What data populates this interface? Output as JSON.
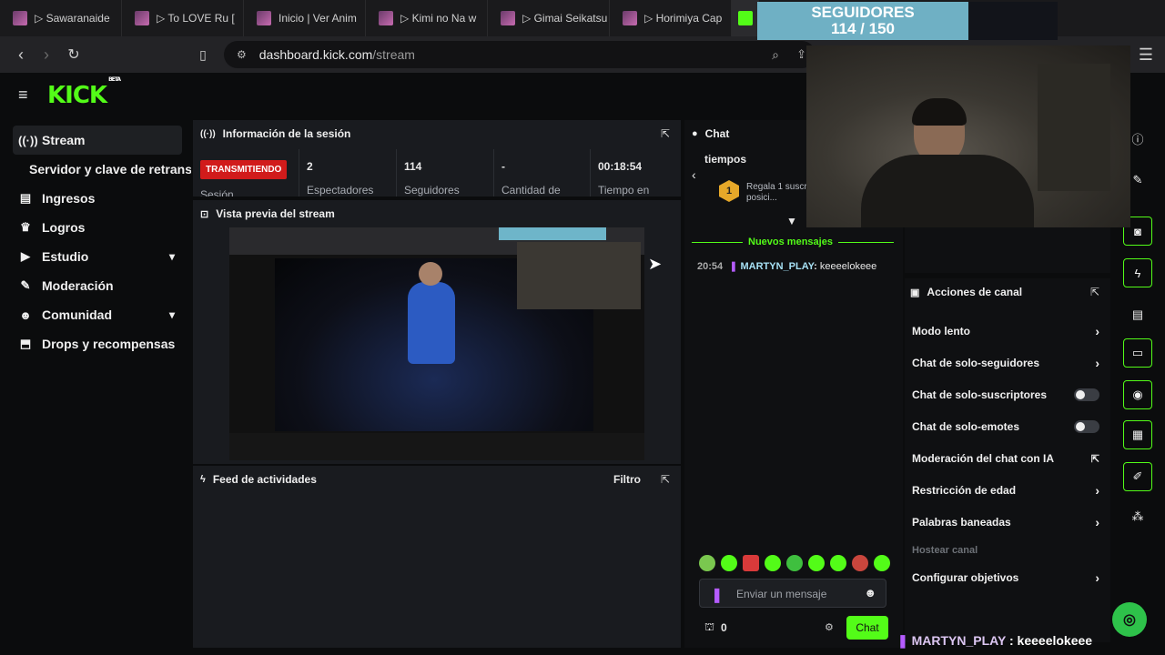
{
  "browser": {
    "tabs": [
      {
        "label": "▷ Sawaranaide"
      },
      {
        "label": "▷ To LOVE Ru ["
      },
      {
        "label": "Inicio | Ver Anim"
      },
      {
        "label": "▷ Kimi no Na w"
      },
      {
        "label": "▷ Gimai Seikatsu"
      },
      {
        "label": "▷ Horimiya Cap"
      }
    ],
    "url_host": "dashboard.kick.com",
    "url_path": "/stream"
  },
  "brand": {
    "logo": "KICK",
    "tag": "BETA",
    "accent": "#53fc18"
  },
  "sidebar": {
    "items": [
      {
        "label": "Stream",
        "icon": "broadcast-icon"
      },
      {
        "label": "Servidor y clave de retransmisión"
      },
      {
        "label": "Ingresos",
        "icon": "money-icon"
      },
      {
        "label": "Logros",
        "icon": "trophy-icon"
      },
      {
        "label": "Estudio",
        "icon": "video-icon"
      },
      {
        "label": "Moderación",
        "icon": "wrench-icon"
      },
      {
        "label": "Comunidad",
        "icon": "people-icon"
      },
      {
        "label": "Drops y recompensas",
        "icon": "gift-icon"
      }
    ]
  },
  "session": {
    "title": "Información de la sesión",
    "status": "TRANSMITIENDO",
    "status_label": "Sesión",
    "stats": [
      {
        "value": "2",
        "label": "Espectadores"
      },
      {
        "value": "114",
        "label": "Seguidores"
      },
      {
        "value": "-",
        "label": "Cantidad de"
      },
      {
        "value": "00:18:54",
        "label": "Tiempo en"
      }
    ]
  },
  "preview": {
    "title": "Vista previa del stream"
  },
  "feed": {
    "title": "Feed de actividades",
    "filter": "Filtro"
  },
  "chat": {
    "title": "Chat",
    "gift_line1": "tiempos",
    "gift_text": "Regala 1 suscr... tomar la posici...",
    "gift_rank": "1",
    "new_messages": "Nuevos mensajes",
    "messages": [
      {
        "time": "20:54",
        "user": "MARTYN_PLAY",
        "text": "keeeelokeee"
      }
    ],
    "input_placeholder": "Enviar un mensaje",
    "count": "0",
    "send": "Chat"
  },
  "actions": {
    "title": "Acciones de canal",
    "items": [
      {
        "label": "Modo lento",
        "control": "chevron"
      },
      {
        "label": "Chat de solo-seguidores",
        "control": "chevron"
      },
      {
        "label": "Chat de solo-suscriptores",
        "control": "toggle"
      },
      {
        "label": "Chat de solo-emotes",
        "control": "toggle"
      },
      {
        "label": "Moderación del chat con IA",
        "control": "external"
      },
      {
        "label": "Restricción de edad",
        "control": "chevron"
      },
      {
        "label": "Palabras baneadas",
        "control": "chevron"
      },
      {
        "label": "Hostear canal",
        "control": "none"
      },
      {
        "label": "Configurar objetivos",
        "control": "chevron"
      }
    ]
  },
  "overlay": {
    "goal_title": "SEGUIDORES",
    "goal_count": "114 / 150",
    "goal_progress": 0.76,
    "chat_user": "MARTYN_PLAY",
    "chat_text": "keeeelokeee"
  }
}
